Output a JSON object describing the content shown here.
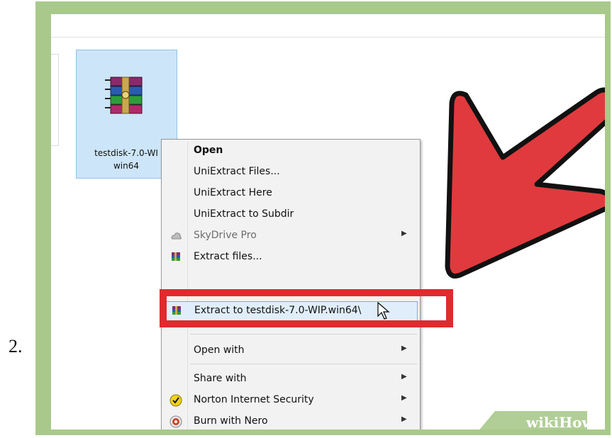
{
  "step": {
    "number": "2."
  },
  "file": {
    "name": "testdisk-7.0-WI\nwin64",
    "icon": "winrar-archive-icon"
  },
  "menu": {
    "items": [
      {
        "label": "Open",
        "bold": true
      },
      {
        "label": "UniExtract Files..."
      },
      {
        "label": "UniExtract Here"
      },
      {
        "label": "UniExtract to Subdir"
      },
      {
        "label": "SkyDrive Pro",
        "icon": "skydrive-icon",
        "submenu": true,
        "disabled": true
      },
      {
        "label": "Extract files...",
        "icon": "winrar-icon"
      },
      {
        "label": "Extract to testdisk-7.0-WIP.win64\\",
        "icon": "winrar-icon",
        "highlighted": true
      },
      {
        "label": "Open with",
        "submenu": true
      },
      {
        "label": "Share with",
        "submenu": true
      },
      {
        "label": "Norton Internet Security",
        "icon": "norton-icon",
        "submenu": true
      },
      {
        "label": "Burn with Nero",
        "icon": "nero-icon",
        "submenu": true
      }
    ]
  },
  "annotation": {
    "color": "#e02a2e",
    "arrow": "red-arrow-icon"
  },
  "watermark": {
    "wiki": "wiki",
    "how": "How"
  },
  "colors": {
    "frame": "#a9c98c",
    "selection": "#cde5f8",
    "highlight": "#e0eefb"
  }
}
